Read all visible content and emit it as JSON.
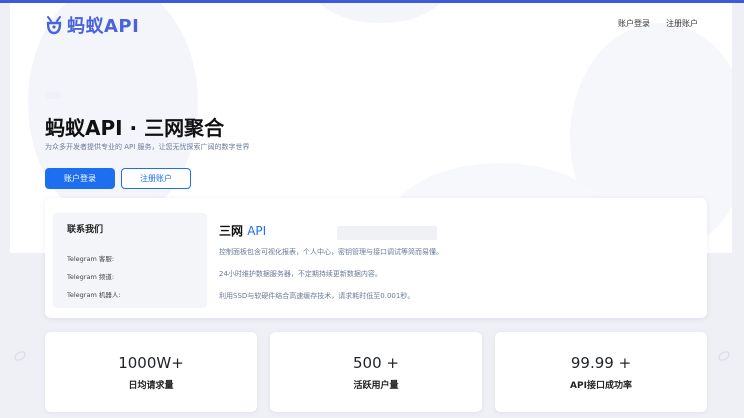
{
  "brand": {
    "name": "蚂蚁API",
    "color": "#4b63d8"
  },
  "nav": {
    "login": "账户登录",
    "register": "注册账户"
  },
  "hero": {
    "title": "蚂蚁API · 三网聚合",
    "subtitle": "为众多开发者提供专业的 API 服务，让您无忧探索广阔的数字世界",
    "primary_button": "账户登录",
    "secondary_button": "注册账户"
  },
  "contact": {
    "title": "联系我们",
    "items": [
      "Telegram 客服:",
      "Telegram 频道:",
      "Telegram 机器人:"
    ]
  },
  "feature": {
    "title_main": "三网",
    "title_accent": "API",
    "lines": [
      "控制面板包含可视化报表，个人中心，密钥管理与接口调试等简而易懂。",
      "24小时维护数据服务器，不定期持续更新数据内容。",
      "利用SSD与软硬件结合高速缓存技术，请求耗时低至0.001秒。"
    ]
  },
  "stats": [
    {
      "value": "1000W+",
      "label": "日均请求量"
    },
    {
      "value": "500 +",
      "label": "活跃用户量"
    },
    {
      "value": "99.99 +",
      "label": "API接口成功率"
    }
  ],
  "colors": {
    "primary": "#1e6ef0",
    "background": "#eef0f5"
  }
}
